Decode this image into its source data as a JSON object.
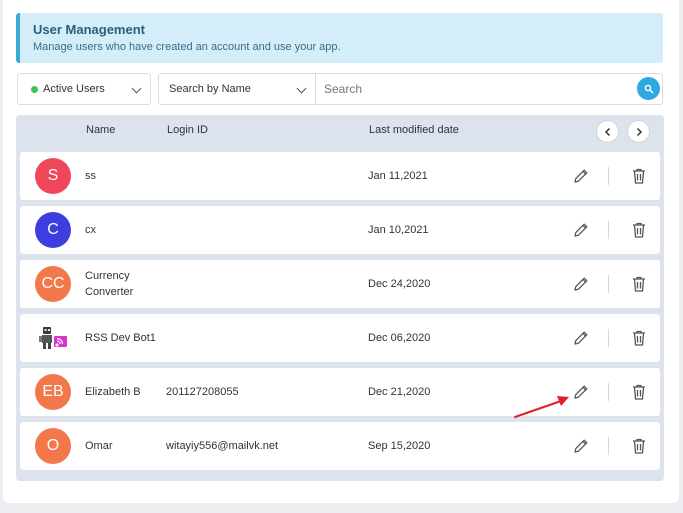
{
  "header": {
    "title": "User Management",
    "subtitle": "Manage users who have created an account and use your app."
  },
  "filters": {
    "status_label": "Active Users",
    "status_color": "#3dc45e",
    "search_by_label": "Search by Name",
    "search_placeholder": "Search"
  },
  "table": {
    "columns": {
      "name": "Name",
      "login": "Login ID",
      "modified": "Last modified date"
    },
    "rows": [
      {
        "initials": "S",
        "color": "#f0465a",
        "name": "ss",
        "login": "",
        "date": "Jan 11,2021"
      },
      {
        "initials": "C",
        "color": "#3d3de0",
        "name": "cx",
        "login": "",
        "date": "Jan 10,2021"
      },
      {
        "initials": "CC",
        "color": "#f2784b",
        "name": "Currency Converter",
        "login": "",
        "date": "Dec 24,2020"
      },
      {
        "initials": "",
        "color": "",
        "icon": "robot-icon",
        "name": "RSS Dev Bot1",
        "login": "",
        "date": "Dec 06,2020"
      },
      {
        "initials": "EB",
        "color": "#f2784b",
        "name": "Elizabeth B",
        "login": "201127208055",
        "date": "Dec 21,2020"
      },
      {
        "initials": "O",
        "color": "#f2784b",
        "name": "Omar",
        "login": "witayiy556@mailvk.net",
        "date": "Sep 15,2020"
      }
    ]
  },
  "icons": {
    "search": "search-icon",
    "prev": "chevron-left-icon",
    "next": "chevron-right-icon",
    "edit": "pencil-icon",
    "delete": "trash-icon",
    "annotation": "red-arrow-annotation"
  },
  "colors": {
    "accent": "#2ea8e0",
    "banner_bg": "#d4eef9",
    "annotation": "#e0202a"
  }
}
